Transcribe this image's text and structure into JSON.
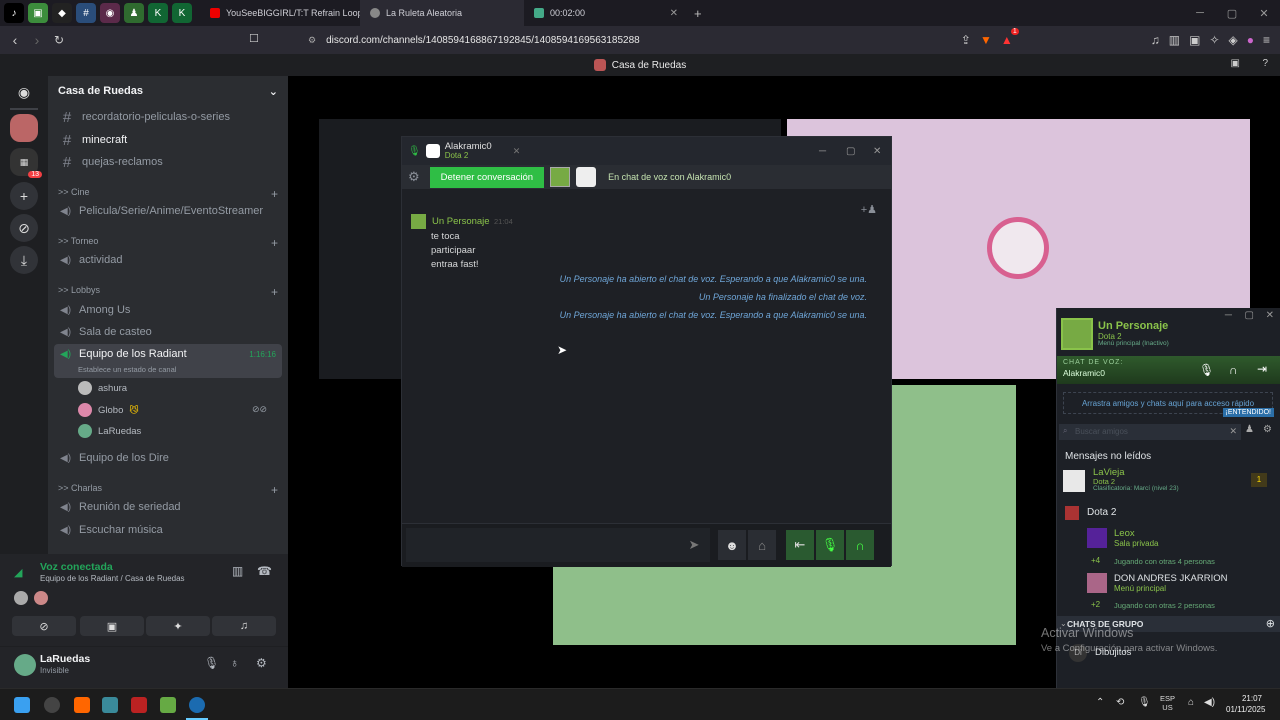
{
  "browser": {
    "tabs": [
      {
        "title": "YouSeeBIGGIRL/T:T Refrain Loop Exte"
      },
      {
        "title": "La Ruleta Aleatoria"
      },
      {
        "title": "00:02:00"
      }
    ],
    "url": "discord.com/channels/1408594168867192845/1408594169563185288",
    "alert_badge": "1"
  },
  "discord": {
    "page_title": "Casa de Ruedas",
    "server_name": "Casa de Ruedas",
    "server_badge": "13",
    "channels_top": [
      {
        "name": "recordatorio-peliculas-o-series"
      },
      {
        "name": "minecraft"
      },
      {
        "name": "quejas-reclamos"
      }
    ],
    "categories": {
      "cine": ">> Cine",
      "torneo": ">> Torneo",
      "lobbys": ">> Lobbys",
      "charlas": ">> Charlas"
    },
    "voice_channels": {
      "cine": "Pelicula/Serie/Anime/EventoStreamer",
      "torneo": "actividad",
      "among": "Among Us",
      "casteo": "Sala de casteo",
      "radiant": "Equipo de los Radiant",
      "radiant_time": "1:16:16",
      "radiant_status": "Establece un estado de canal",
      "dire": "Equipo de los Dire",
      "seriedad": "Reunión de seriedad",
      "musica": "Escuchar música"
    },
    "members": [
      "ashura",
      "Globo",
      "LaRuedas"
    ],
    "voice_panel": {
      "status": "Voz conectada",
      "location": "Equipo de los Radiant / Casa de Ruedas"
    },
    "user": {
      "name": "LaRuedas",
      "status": "Invisible"
    }
  },
  "steam_chat": {
    "contact": "Alakramic0",
    "game": "Dota 2",
    "stop_label": "Detener conversación",
    "voice_status": "En chat de voz con Alakramic0",
    "message": {
      "author": "Un Personaje",
      "time": "21:04",
      "lines": [
        "te toca",
        "participaar",
        "entraa fast!"
      ]
    },
    "system_messages": [
      "Un Personaje ha abierto el chat de voz. Esperando a que Alakramic0 se una.",
      "Un Personaje ha finalizado el chat de voz.",
      "Un Personaje ha abierto el chat de voz. Esperando a que Alakramic0 se una."
    ]
  },
  "steam_friends": {
    "self_name": "Un Personaje",
    "self_game": "Dota 2",
    "self_status": "Menú principal (Inactivo)",
    "voice_label": "CHAT DE VOZ:",
    "voice_with": "Alakramic0",
    "drag_hint": "Arrastra amigos y chats aquí para acceso rápido",
    "got_it": "¡ENTENDIDO!",
    "search_placeholder": "Buscar amigos",
    "unread_header": "Mensajes no leídos",
    "unread": {
      "name": "LaVieja",
      "game": "Dota 2",
      "detail": "Clasificatoria: Marcí (nivel 23)",
      "count": "1"
    },
    "group_name": "Dota 2",
    "friends": [
      {
        "name": "Leox",
        "status": "Sala privada",
        "plus": "+4",
        "note": "Jugando con otras 4 personas"
      },
      {
        "name": "DON ANDRES JKARRION",
        "status": "Menú principal",
        "plus": "+2",
        "note": "Jugando con otras 2 personas"
      }
    ],
    "group_chats": "CHATS DE GRUPO",
    "group_chat_item": {
      "initials": "Di",
      "name": "Dibujitos"
    }
  },
  "watermark": {
    "title": "Activar Windows",
    "subtitle": "Ve a Configuración para activar Windows."
  },
  "taskbar": {
    "lang": "ESP",
    "region": "US",
    "time": "21:07",
    "date": "01/11/2025"
  },
  "colors": {
    "green": "#2fbe45",
    "discord_bg": "#2b2d31",
    "blurple_pink": "#dcc4dc",
    "green_panel": "#8fbf8a"
  }
}
